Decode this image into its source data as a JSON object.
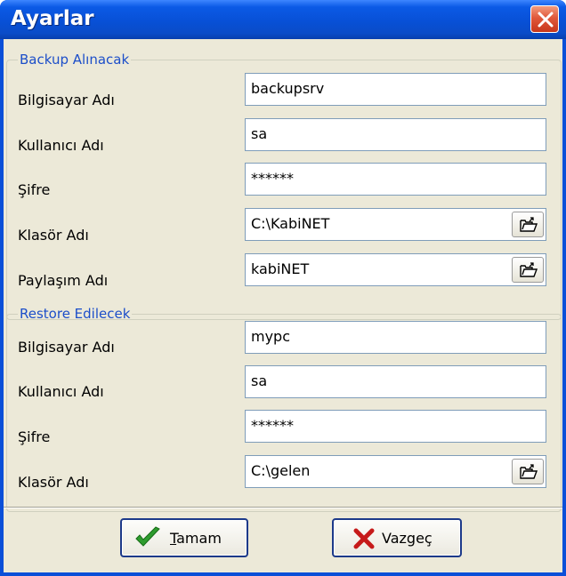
{
  "window": {
    "title": "Ayarlar"
  },
  "backup_group": {
    "legend": "Backup Alınacak",
    "fields": [
      {
        "label": "Bilgisayar Adı",
        "value": "backupsrv"
      },
      {
        "label": "Kullanıcı Adı",
        "value": "sa"
      },
      {
        "label": "Şifre",
        "value": "******"
      },
      {
        "label": "Klasör Adı",
        "value": "C:\\KabiNET"
      },
      {
        "label": "Paylaşım Adı",
        "value": "kabiNET"
      }
    ]
  },
  "restore_group": {
    "legend": "Restore Edilecek",
    "fields": [
      {
        "label": "Bilgisayar Adı",
        "value": "mypc"
      },
      {
        "label": "Kullanıcı Adı",
        "value": "sa"
      },
      {
        "label": "Şifre",
        "value": "******"
      },
      {
        "label": "Klasör Adı",
        "value": "C:\\gelen"
      }
    ]
  },
  "buttons": {
    "ok": {
      "mnemonic": "T",
      "rest": "amam",
      "icon": "checkmark-icon"
    },
    "cancel": {
      "label": "Vazgeç",
      "icon": "x-icon"
    }
  },
  "colors": {
    "title_bar": "#0a4fd8",
    "client_bg": "#ece9d8",
    "legend_text": "#1c4ec9",
    "close_button": "#e0583a"
  }
}
